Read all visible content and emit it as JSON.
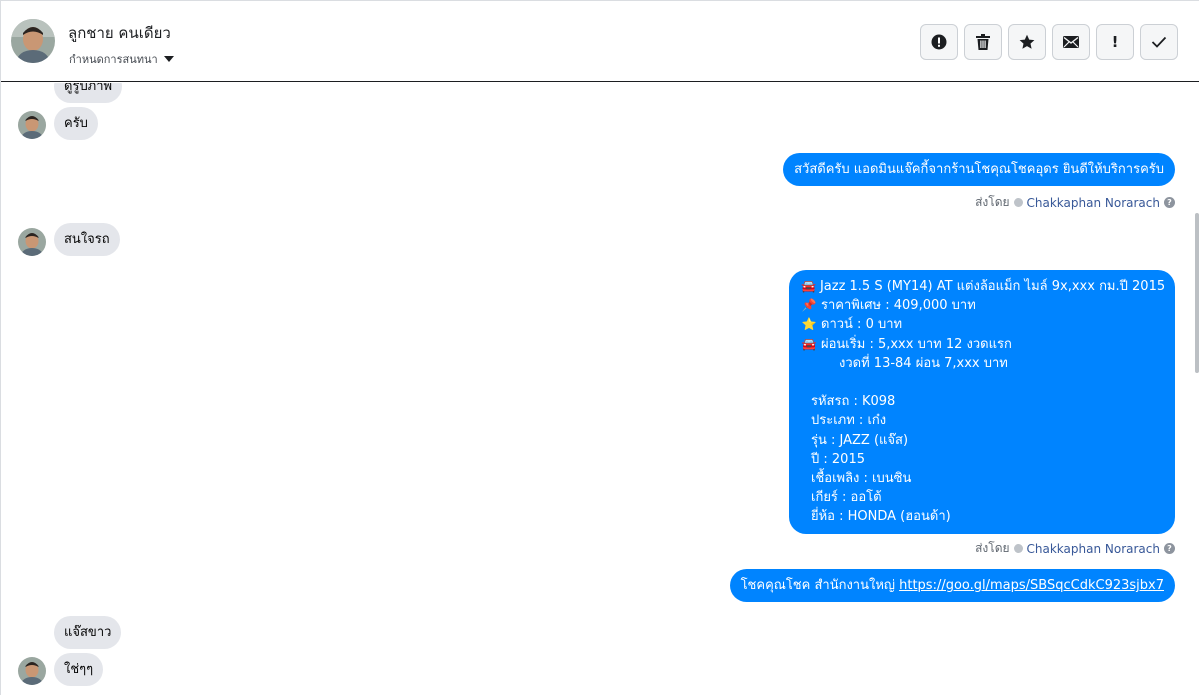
{
  "header": {
    "contact_name": "ลูกชาย คนเดียว",
    "assign_label": "กำหนดการสนทนา",
    "toolbar": [
      {
        "name": "spam-button",
        "icon": "alert-circle-icon"
      },
      {
        "name": "delete-button",
        "icon": "trash-icon"
      },
      {
        "name": "star-button",
        "icon": "star-icon"
      },
      {
        "name": "mark-unread-button",
        "icon": "envelope-icon"
      },
      {
        "name": "important-button",
        "icon": "exclamation-icon"
      },
      {
        "name": "done-button",
        "icon": "check-icon"
      }
    ]
  },
  "messages": {
    "m1": "ดูรูปภาพ",
    "m2": "ครับ",
    "m3": "สวัสดีครับ แอดมินแจ๊คกี้จากร้านโชคุณโชคอุดร ยินดีให้บริการครับ",
    "m4": "สนใจรถ",
    "m6": "โชคคุณโชค สำนักงานใหญ่ ",
    "m6_link": "https://goo.gl/maps/SBSqcCdkC923sjbx7",
    "m7": "แจ๊สขาว",
    "m8": "ใช่ๆๆ"
  },
  "sent_by": {
    "prefix": "ส่งโดย",
    "name": "Chakkaphan Norarach",
    "help": "?"
  },
  "car_card": {
    "line1": "Jazz 1.5 S (MY14) AT แต่งล้อแม็ก ไมล์ 9x,xxx กม.ปี 2015",
    "line2": "ราคาพิเศษ : 409,000 บาท",
    "line3": "ดาวน์ : 0 บาท",
    "line4": "ผ่อนเริ่ม : 5,xxx บาท 12 งวดแรก",
    "line5": "งวดที่ 13-84 ผ่อน 7,xxx บาท",
    "spec_code": "รหัสรถ : K098",
    "spec_type": "ประเภท : เก๋ง",
    "spec_model": "รุ่น : JAZZ (แจ๊ส)",
    "spec_year": "ปี : 2015",
    "spec_fuel": "เชื้อเพลิง : เบนซิน",
    "spec_gear": "เกียร์ : ออโต้",
    "spec_brand": "ยี่ห้อ : HONDA (ฮอนด้า)",
    "emoji_car": "🚘",
    "emoji_pin": "📌",
    "emoji_star": "⭐"
  }
}
